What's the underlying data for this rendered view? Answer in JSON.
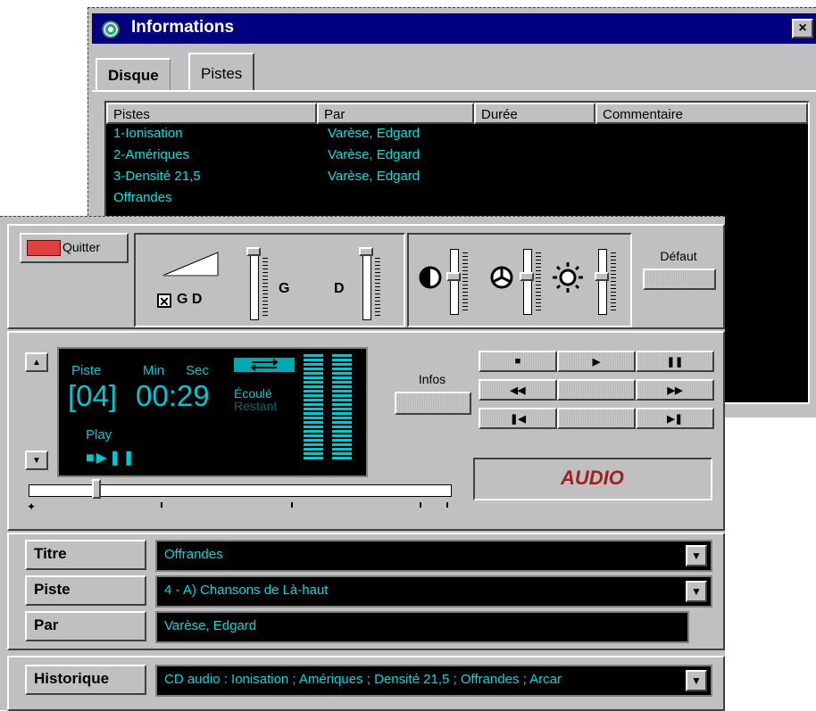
{
  "info_window": {
    "title": "Informations",
    "close_label": "×",
    "tabs": [
      "Disque",
      "Pistes"
    ],
    "columns": [
      "Pistes",
      "Par",
      "Durée",
      "Commentaire"
    ],
    "rows": [
      {
        "piste": "1-Ionisation",
        "par": "Varèse, Edgard"
      },
      {
        "piste": "2-Amériques",
        "par": "Varèse, Edgard"
      },
      {
        "piste": "3-Densité 21,5",
        "par": "Varèse, Edgard"
      },
      {
        "piste": "Offrandes",
        "par": ""
      }
    ]
  },
  "player": {
    "quit_label": "Quitter",
    "balance_label": "G D",
    "balance_checked": true,
    "left_label": "G",
    "right_label": "D",
    "default_label": "Défaut",
    "display": {
      "piste_label": "Piste",
      "min_label": "Min",
      "sec_label": "Sec",
      "track": "[04]",
      "time": "00:29",
      "elapsed": "Écoulé",
      "remaining": "Restant",
      "status": "Play"
    },
    "infos_label": "Infos",
    "audio_logo": "AUDIO",
    "progress": 0.16
  },
  "fields": {
    "titre_label": "Titre",
    "titre_value": "Offrandes",
    "piste_label": "Piste",
    "piste_value": "4 - A) Chansons de Là-haut",
    "par_label": "Par",
    "par_value": "Varèse, Edgard",
    "historique_label": "Historique",
    "historique_value": "CD audio : Ionisation ; Amériques ; Densité 21,5 ; Offrandes ; Arcar"
  },
  "colors": {
    "lcd_text": "#00d8e0",
    "titlebar": "#000080",
    "face": "#c0c0c0",
    "audio": "#a02020"
  }
}
